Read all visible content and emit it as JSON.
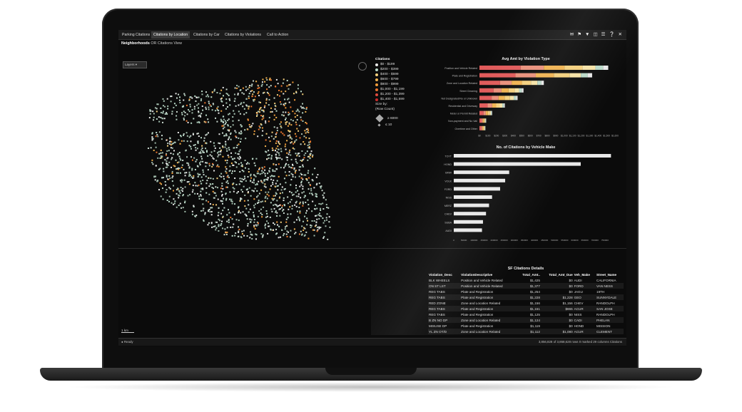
{
  "tabs": [
    "Parking Citations",
    "Citations by Location",
    "Citations by Car",
    "Citations by Violations",
    "Call to Action"
  ],
  "active_tab_index": 1,
  "subtitle": {
    "bold": "Neighborhoods",
    "rest": "OR Citations View"
  },
  "map": {
    "layers_label": "Layers",
    "scale_label": "1 km"
  },
  "legend": {
    "title": "Citations",
    "items": [
      {
        "label": "$0 - $199",
        "color": "#e8e8e8"
      },
      {
        "label": "$200 - $399",
        "color": "#b9d9c8"
      },
      {
        "label": "$400 - $599",
        "color": "#f3cf7c"
      },
      {
        "label": "$600 - $799",
        "color": "#f0b24f"
      },
      {
        "label": "$800 - $999",
        "color": "#f09b39"
      },
      {
        "label": "$1,000 - $1,199",
        "color": "#e9752e"
      },
      {
        "label": "$1,200 - $1,399",
        "color": "#e04b3d"
      },
      {
        "label": "$1,400 - $1,599",
        "color": "#c92a2a"
      }
    ],
    "size_by_label": "Size by:",
    "size_by_value": "(Row Count)",
    "size_max": "≥ 6000",
    "size_min": "≤ 10"
  },
  "chart_data": [
    {
      "type": "bar",
      "orientation": "horizontal",
      "stacked": true,
      "title": "Avg Amt by Violation Type",
      "categories": [
        "Position and Vehicle Related",
        "Plate and Registration",
        "Zone and Location Related",
        "Street Cleaning",
        "Not Designated/No or Unknown",
        "Residential and Driveway",
        "Meter or Permit Related",
        "Non-payment and No Vali",
        "Overtime and Other"
      ],
      "values": [
        1520,
        1330,
        760,
        520,
        450,
        300,
        150,
        80,
        70
      ],
      "segment_colors": [
        "#e05a5a",
        "#e98f7a",
        "#f0b24f",
        "#f3cf7c",
        "#f5e2a6",
        "#b9d9c8",
        "#e8e8e8"
      ],
      "xticks": [
        "$0",
        "$100",
        "$200",
        "$300",
        "$400",
        "$500",
        "$600",
        "$700",
        "$800",
        "$900",
        "$1,000",
        "$1,100",
        "$1,200",
        "$1,300",
        "$1,400",
        "$1,500",
        "$1,600"
      ],
      "xlim": [
        0,
        1600
      ]
    },
    {
      "type": "bar",
      "orientation": "horizontal",
      "title": "No. of Citations by Vehicle Make",
      "categories": [
        "TOYT",
        "HOND",
        "BMW",
        "VOLK",
        "FORD",
        "NISS",
        "MERZ",
        "CHEV",
        "SUBA",
        "AUDI"
      ],
      "values": [
        780000,
        630000,
        275000,
        255000,
        230000,
        190000,
        175000,
        160000,
        145000,
        140000
      ],
      "bar_color": "#e8e8e8",
      "xticks": [
        "0",
        "50000",
        "100000",
        "150000",
        "200000",
        "250000",
        "300000",
        "350000",
        "400000",
        "450000",
        "500000",
        "550000",
        "600000",
        "650000",
        "700000",
        "750000"
      ],
      "xlim": [
        0,
        800000
      ]
    }
  ],
  "table": {
    "title": "SF Citations Details",
    "columns": [
      "Violation_Desc",
      "ViolationDescriptive",
      "Total_Amt..",
      "Total_Amt_Due",
      "Veh_Make",
      "Street_Name"
    ],
    "rows": [
      [
        "BLK WHEELS",
        "Position and Vehicle Related",
        "$1,425",
        "$0",
        "AUDI",
        "CALIFORNIA"
      ],
      [
        "ON ST LST",
        "Position and Vehicle Related",
        "$1,377",
        "$0",
        "FORD",
        "VAN NESS"
      ],
      [
        "REG TABS",
        "Plate and Registration",
        "$1,254",
        "$0",
        "JAGU",
        "19TH"
      ],
      [
        "REG TABS",
        "Plate and Registration",
        "$1,228",
        "$1,228",
        "GEO",
        "SUNNYDALE"
      ],
      [
        "RED ZONE",
        "Zone and Location Related",
        "$1,156",
        "$1,156",
        "CHEV",
        "RANDOLPH"
      ],
      [
        "REG TABS",
        "Plate and Registration",
        "$1,151",
        "$865",
        "ACUR",
        "SAN JOSE"
      ],
      [
        "REG TABS",
        "Plate and Registration",
        "$1,125",
        "$0",
        "NISS",
        "RANDOLPH"
      ],
      [
        "B ZN NO DP",
        "Zone and Location Related",
        "$1,124",
        "$0",
        "CADI",
        "PHELAN"
      ],
      [
        "MISUSE DP",
        "Plate and Registration",
        "$1,119",
        "$0",
        "HOND",
        "MISSION"
      ],
      [
        "YL ZN OT/D",
        "Zone and Location Related",
        "$1,112",
        "$1,080",
        "ACUR",
        "CLEMENT"
      ]
    ]
  },
  "status": {
    "left": "Ready",
    "right": "3,856,828 of 3,868,628 rows    0 marked    29 columns    Citations"
  }
}
